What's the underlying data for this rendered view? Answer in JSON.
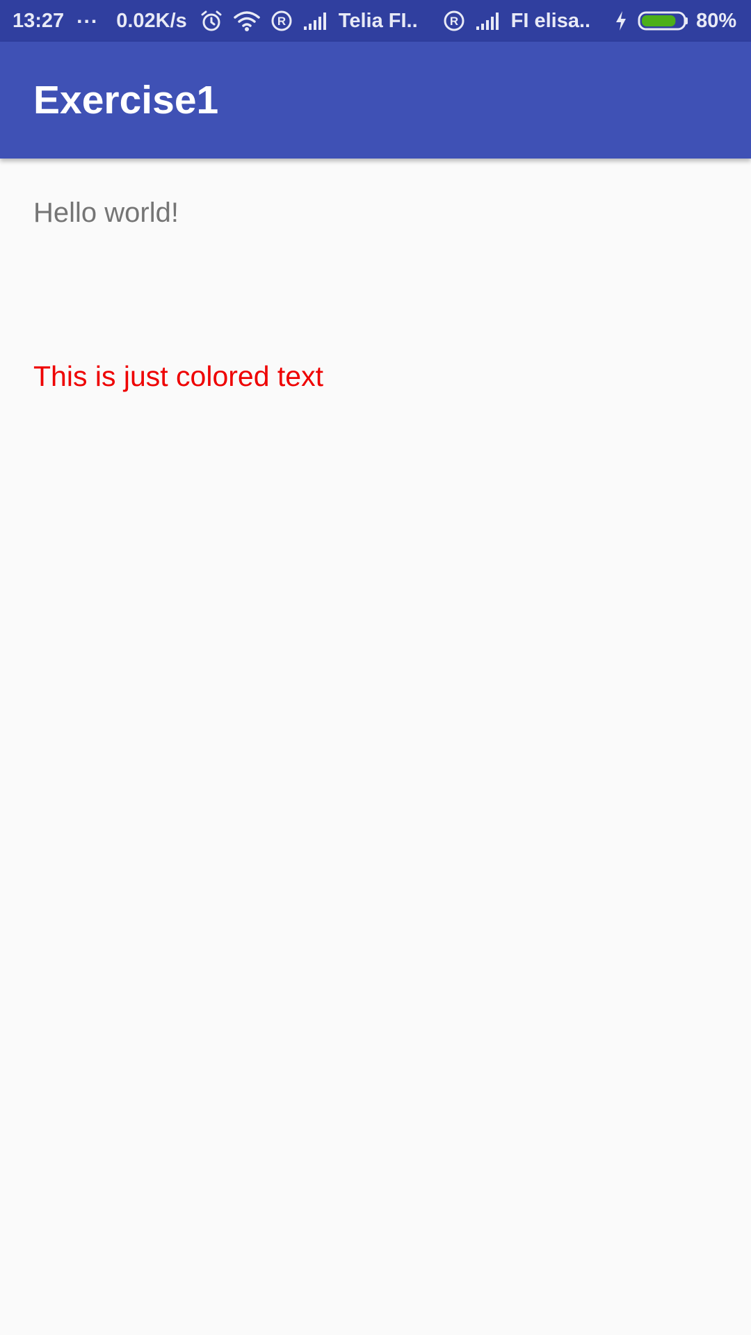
{
  "status_bar": {
    "time": "13:27",
    "more": "...",
    "speed": "0.02K/s",
    "carrier1": "Telia FI..",
    "carrier2": "FI elisa..",
    "battery_percent": "80%",
    "battery_level": 0.8,
    "battery_color": "#4caf1a",
    "icons": [
      "alarm-icon",
      "wifi-icon",
      "roaming-icon",
      "signal-icon",
      "roaming-icon",
      "signal-icon",
      "charging-icon",
      "battery-icon"
    ]
  },
  "app_bar": {
    "title": "Exercise1",
    "color": "#3f51b5"
  },
  "main": {
    "hello": "Hello world!",
    "colored_text": "This is just colored text",
    "colored_text_color": "#ee0000"
  }
}
